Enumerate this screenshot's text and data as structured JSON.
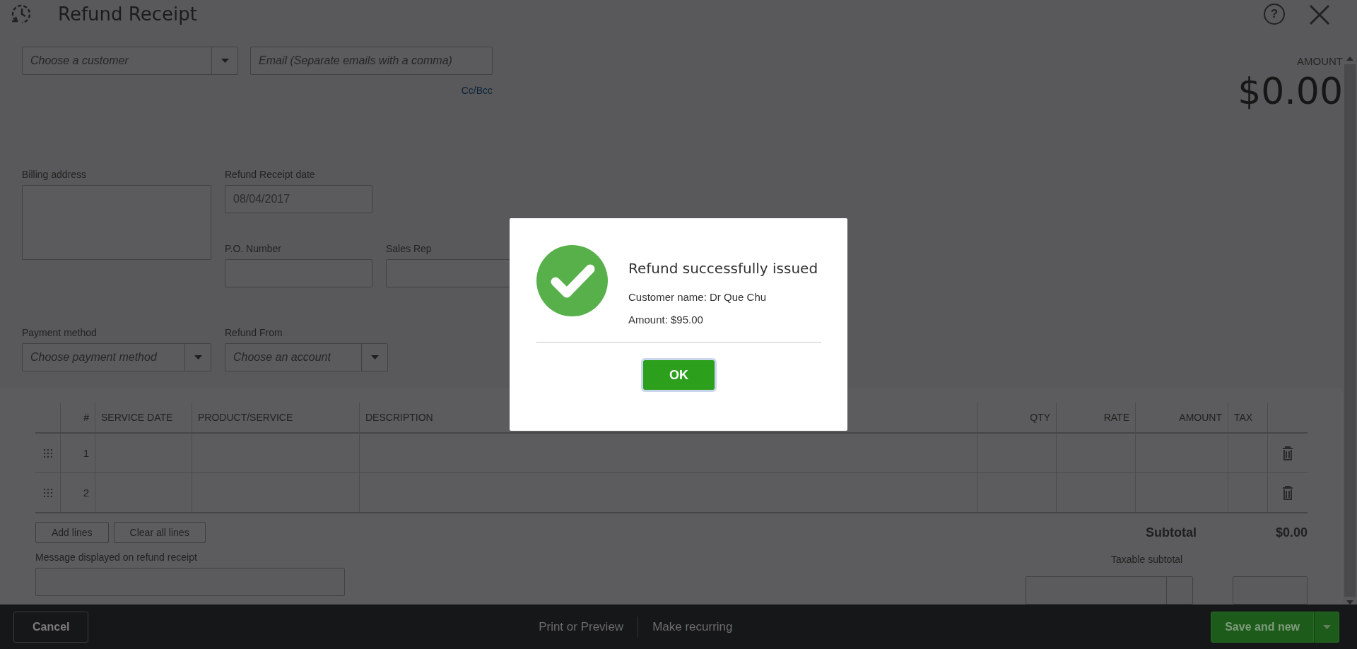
{
  "header": {
    "title": "Refund Receipt",
    "help": "?"
  },
  "customer": {
    "placeholder": "Choose a customer"
  },
  "email": {
    "placeholder": "Email (Separate emails with a comma)"
  },
  "cc_bcc": "Cc/Bcc",
  "amount": {
    "label": "AMOUNT",
    "value": "$0.00"
  },
  "billing_address": {
    "label": "Billing address"
  },
  "refund_receipt_date": {
    "label": "Refund Receipt date",
    "value": "08/04/2017"
  },
  "po_number": {
    "label": "P.O. Number"
  },
  "sales_rep": {
    "label": "Sales Rep"
  },
  "payment_method": {
    "label": "Payment method",
    "placeholder": "Choose payment method"
  },
  "refund_from": {
    "label": "Refund From",
    "placeholder": "Choose an account"
  },
  "table": {
    "columns": [
      "#",
      "SERVICE DATE",
      "PRODUCT/SERVICE",
      "DESCRIPTION",
      "QTY",
      "RATE",
      "AMOUNT",
      "TAX"
    ],
    "rows": [
      {
        "number": "1"
      },
      {
        "number": "2"
      }
    ]
  },
  "line_buttons": [
    "Add lines",
    "Clear all lines"
  ],
  "subtotal": {
    "label": "Subtotal",
    "value": "$0.00"
  },
  "message": {
    "label": "Message displayed on refund receipt"
  },
  "taxable_subtotal": {
    "label": "Taxable subtotal"
  },
  "footer": {
    "cancel": "Cancel",
    "links": [
      "Print or Preview",
      "Make recurring"
    ],
    "save": "Save and new"
  },
  "dialog": {
    "title": "Refund successfully issued",
    "lines": [
      "Customer name: Dr Que Chu",
      "Amount: $95.00"
    ],
    "button": "OK"
  }
}
